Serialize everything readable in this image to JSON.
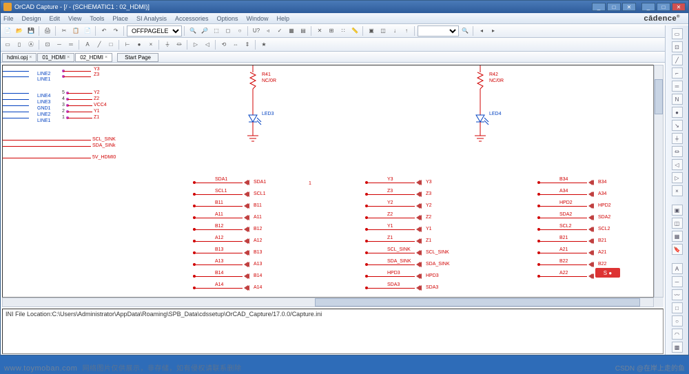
{
  "window": {
    "title": "OrCAD Capture - [/ - (SCHEMATIC1 : 02_HDMI)]",
    "brand": "cādence",
    "btns": {
      "min": "_",
      "max": "□",
      "close": "✕",
      "doc_min": "_",
      "doc_max": "□",
      "doc_close": "✕"
    }
  },
  "menu": [
    "File",
    "Design",
    "Edit",
    "View",
    "Tools",
    "Place",
    "SI Analysis",
    "Accessories",
    "Options",
    "Window",
    "Help"
  ],
  "toolbar": {
    "combo1": "OFFPAGELEFT-R",
    "combo2_placeholder": ""
  },
  "tabs": {
    "items": [
      {
        "label": "hdmi.opj"
      },
      {
        "label": "01_HDMI"
      },
      {
        "label": "02_HDMI"
      }
    ],
    "start": "Start Page"
  },
  "log": {
    "line1": "INI File Location:C:\\Users\\Administrator\\AppData\\Roaming\\SPB_Data\\cdssetup\\OrCAD_Capture/17.0.0/Capture.ini"
  },
  "schematic": {
    "connector": {
      "top": [
        "LINE2",
        "LINE1"
      ],
      "top_pins": [
        "Y3",
        "Z3"
      ],
      "mid": [
        "LINE4",
        "LINE3",
        "GND1",
        "LINE2",
        "LINE1"
      ],
      "mid_nums": [
        "5",
        "4",
        "3",
        "2",
        "1"
      ],
      "mid_pins": [
        "Y2",
        "Z2",
        "VCC4",
        "Y1",
        "Z1"
      ]
    },
    "extra_labels": [
      "SCL_SINK",
      "SDA_SINk",
      "5V_HDMI0"
    ],
    "r41": {
      "ref": "R41",
      "val": "NC/0R",
      "led": "LED3"
    },
    "r42": {
      "ref": "R42",
      "val": "NC/0R",
      "led": "LED4"
    },
    "stray_1": "1",
    "col1": [
      "SDA1",
      "SCL1",
      "B11",
      "A11",
      "B12",
      "A12",
      "B13",
      "A13",
      "B14",
      "A14"
    ],
    "col2": [
      "Y3",
      "Z3",
      "Y2",
      "Z2",
      "Y1",
      "Z1",
      "SCL_SINK",
      "SDA_SINK",
      "HPD3",
      "SDA3"
    ],
    "col3": [
      "B34",
      "A34",
      "HPD2",
      "SDA2",
      "SCL2",
      "B21",
      "A21",
      "B22",
      "A22"
    ]
  },
  "watermark": {
    "site": "www.toymoban.com",
    "note": "网络图片仅供展示，非存储，如有侵权请联系删除",
    "csdn": "CSDN @在岸上走的鱼"
  }
}
